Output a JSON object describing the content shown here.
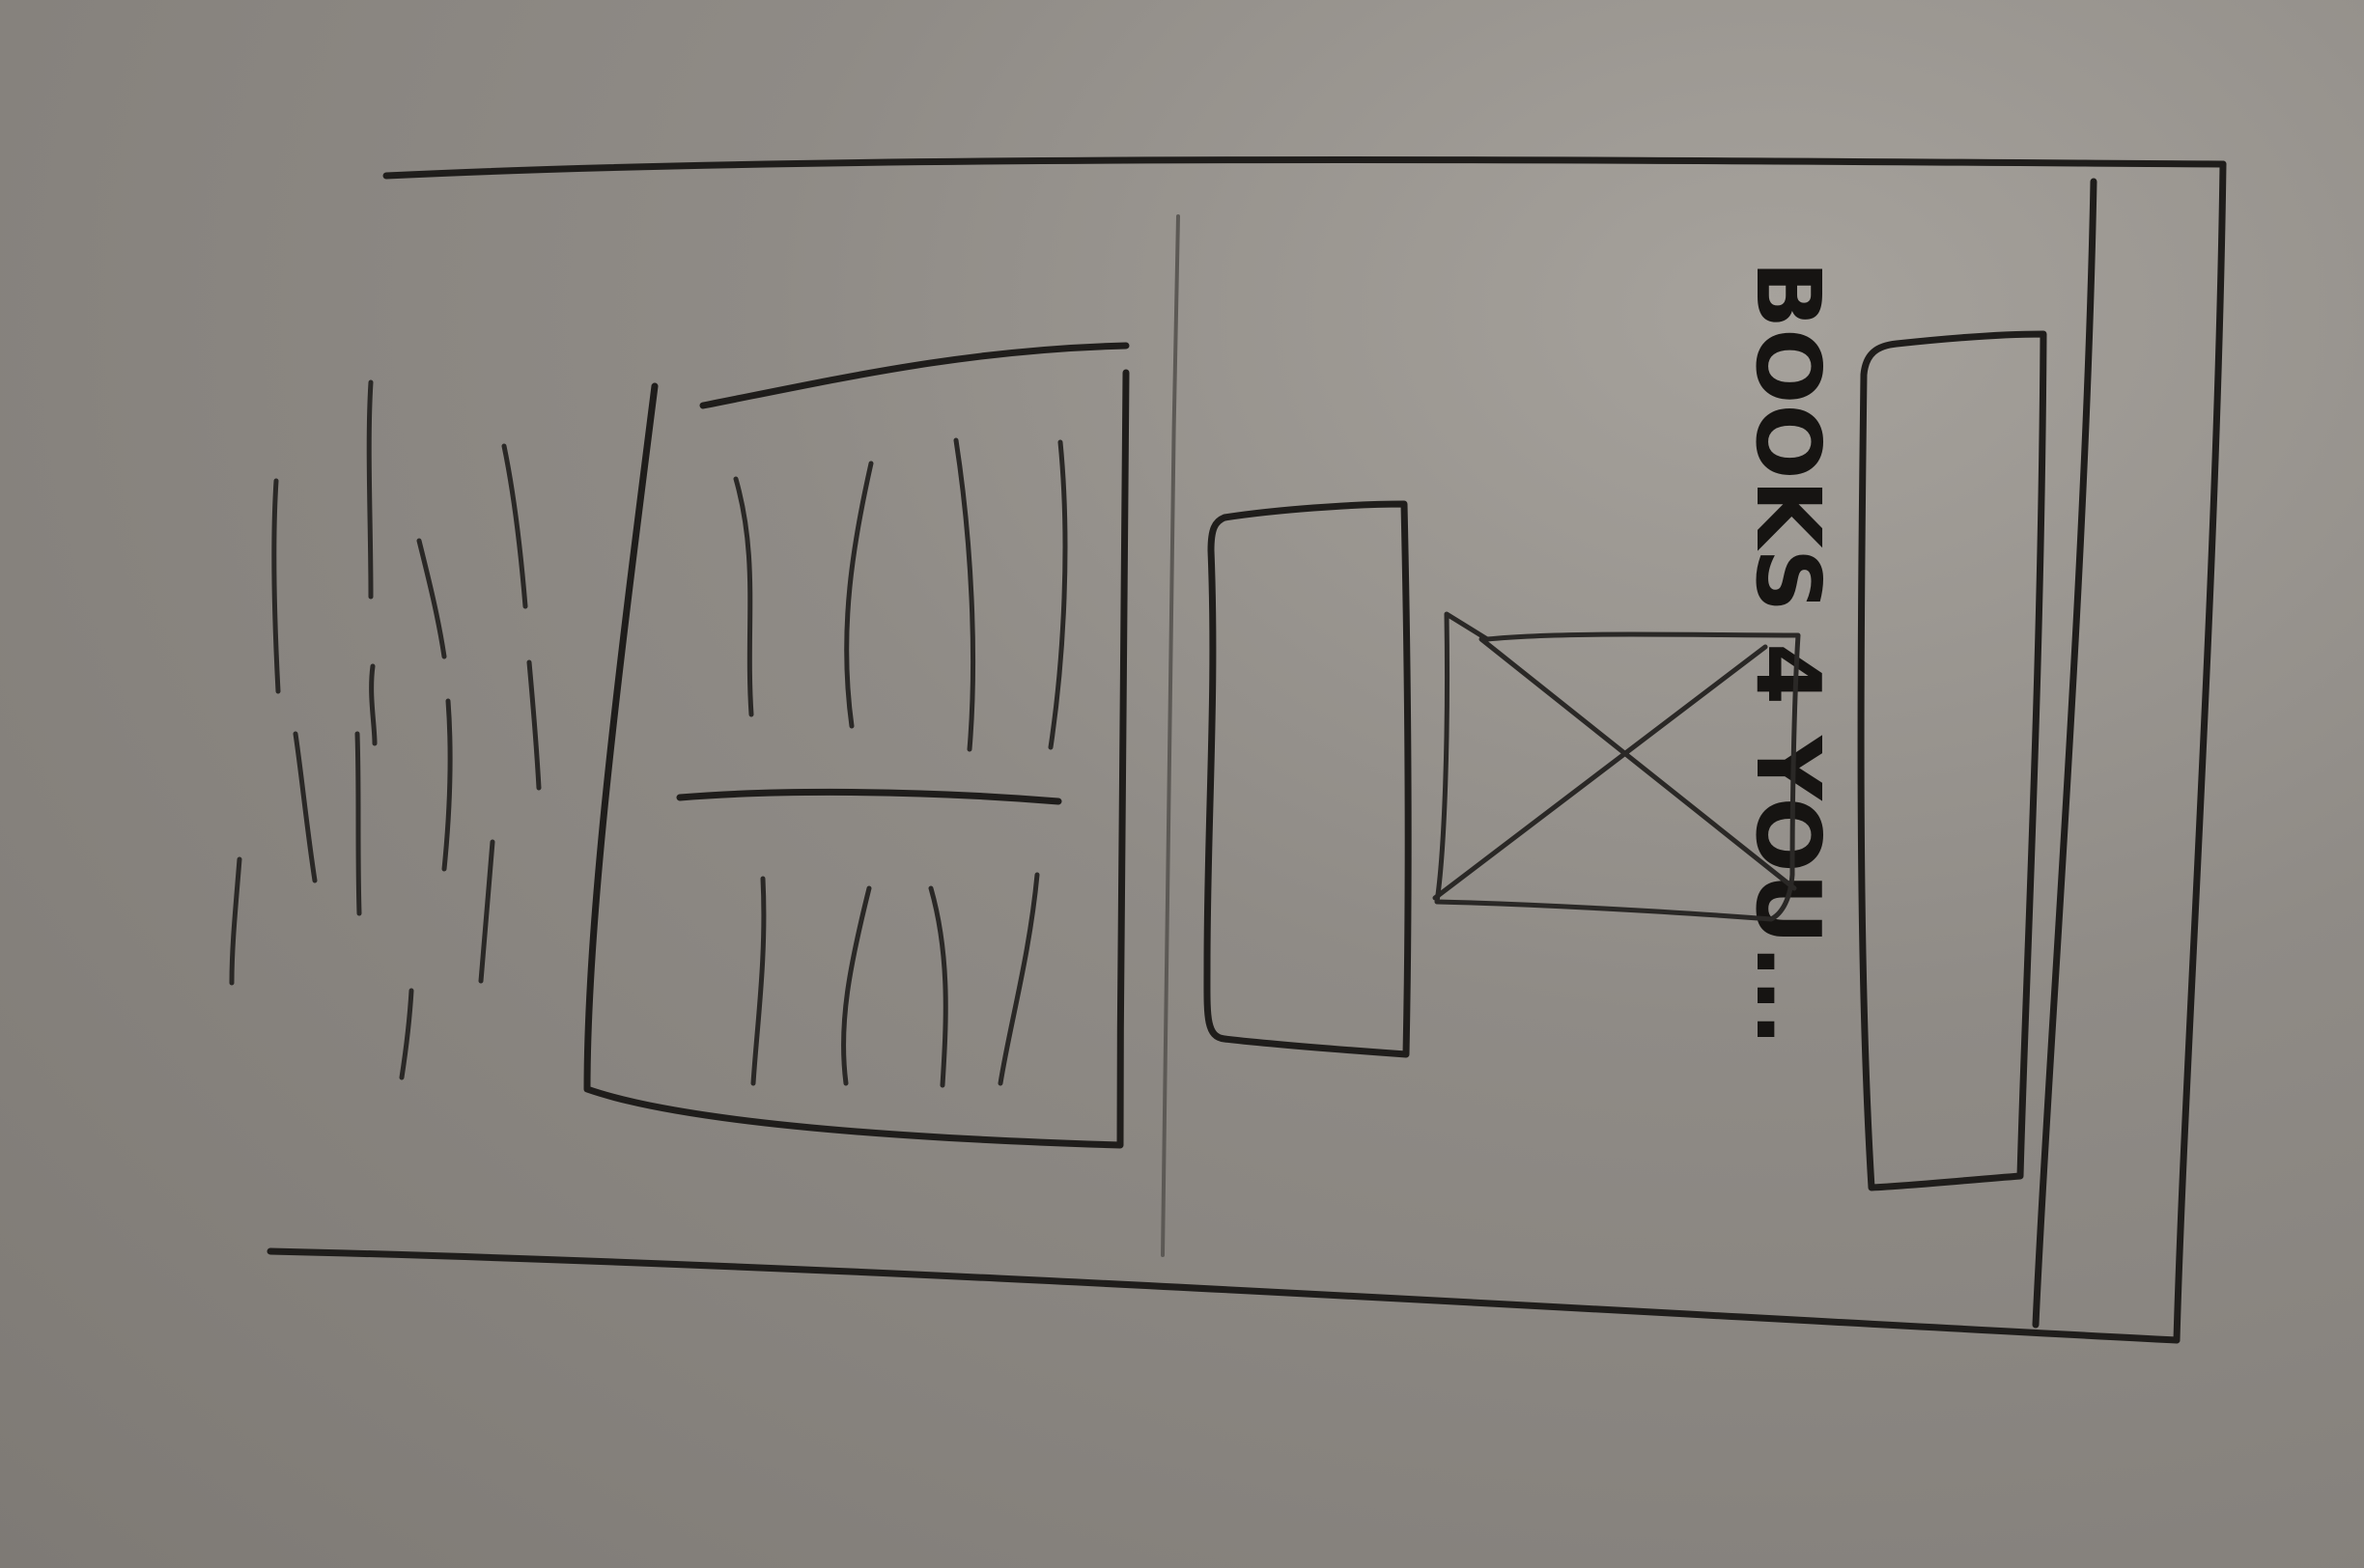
{
  "wireframe": {
    "heading": "BOOKS 4 YOU...",
    "ink_color": "#1f1d1b",
    "paper_color": "#8f8b86"
  }
}
